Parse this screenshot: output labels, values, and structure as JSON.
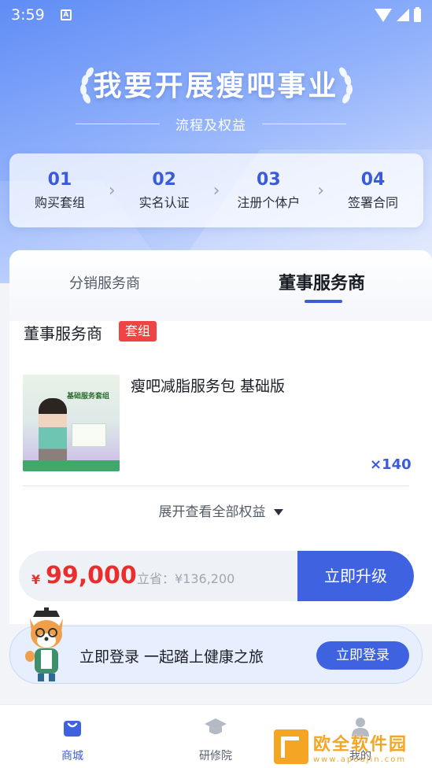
{
  "status_bar": {
    "time": "3:59",
    "notification_icon": "a-icon"
  },
  "hero": {
    "title": "我要开展瘦吧事业",
    "subtitle": "流程及权益"
  },
  "steps": [
    {
      "num": "01",
      "label": "购买套组"
    },
    {
      "num": "02",
      "label": "实名认证"
    },
    {
      "num": "03",
      "label": "注册个体户"
    },
    {
      "num": "04",
      "label": "签署合同"
    }
  ],
  "tabs": {
    "distributor": "分销服务商",
    "director": "董事服务商"
  },
  "package": {
    "title": "董事服务商",
    "badge": "套组",
    "image_text": "基础服务套组",
    "product_name": "瘦吧减脂服务包 基础版",
    "quantity": "×140",
    "expand_label": "展开查看全部权益"
  },
  "price": {
    "currency": "¥",
    "amount": "99,000",
    "savings": "立省：¥136,200",
    "upgrade_label": "立即升级"
  },
  "login_banner": {
    "text": "立即登录 一起踏上健康之旅",
    "button": "立即登录"
  },
  "bottom_nav": [
    {
      "label": "商城",
      "icon": "shopping-bag-icon",
      "active": true
    },
    {
      "label": "研修院",
      "icon": "graduation-cap-icon",
      "active": false
    },
    {
      "label": "我的",
      "icon": "user-icon",
      "active": false
    }
  ],
  "watermark": {
    "title": "欧全软件园",
    "url": "www.apoujin.com"
  },
  "colors": {
    "accent": "#3f63e0",
    "price_red": "#ec2d2d",
    "badge_red": "#f04343"
  }
}
